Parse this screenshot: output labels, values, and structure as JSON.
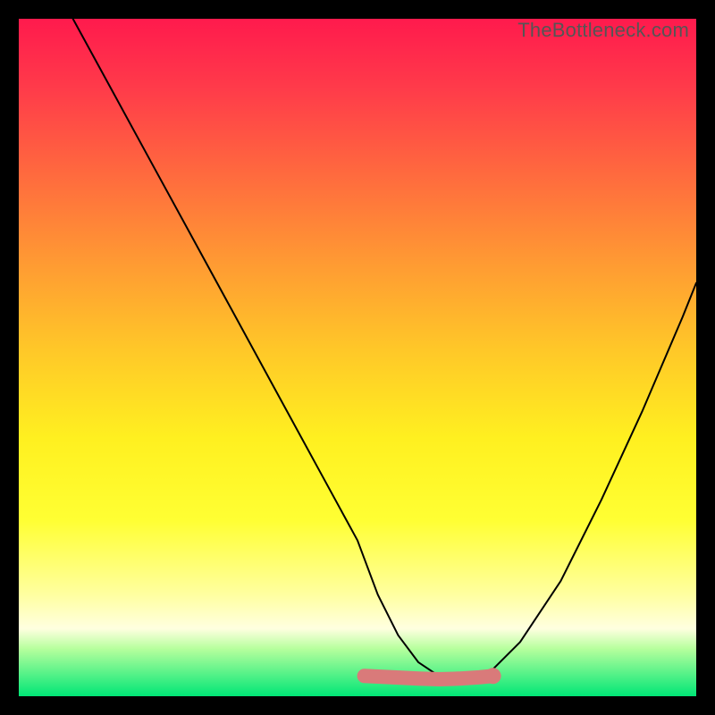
{
  "watermark": "TheBottleneck.com",
  "chart_data": {
    "type": "line",
    "title": "",
    "xlabel": "",
    "ylabel": "",
    "xlim": [
      0,
      100
    ],
    "ylim": [
      0,
      100
    ],
    "series": [
      {
        "name": "curve",
        "x": [
          8,
          14,
          20,
          26,
          32,
          38,
          44,
          50,
          53,
          56,
          59,
          62,
          65,
          68,
          70,
          74,
          80,
          86,
          92,
          98,
          100
        ],
        "y": [
          100,
          89,
          78,
          67,
          56,
          45,
          34,
          23,
          15,
          9,
          5,
          3,
          2.5,
          3,
          4,
          8,
          17,
          29,
          42,
          56,
          61
        ]
      },
      {
        "name": "highlight-band",
        "x": [
          51,
          55,
          59,
          62,
          65,
          68,
          70
        ],
        "y": [
          3.0,
          2.8,
          2.6,
          2.5,
          2.6,
          2.8,
          3.0
        ]
      }
    ],
    "annotations": [
      {
        "name": "highlight-dot",
        "x": 70,
        "y": 3.0
      }
    ]
  }
}
